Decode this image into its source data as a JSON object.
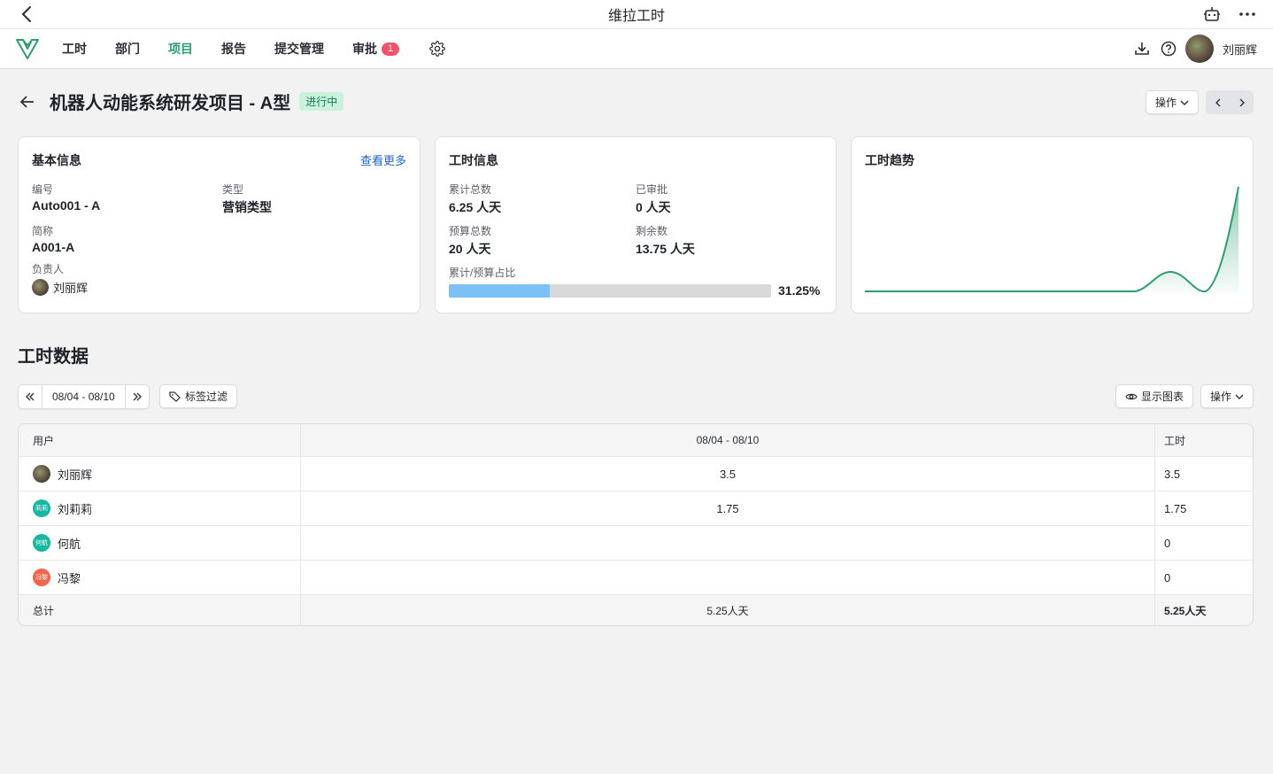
{
  "window": {
    "title": "维拉工时"
  },
  "nav": {
    "items": [
      {
        "label": "工时"
      },
      {
        "label": "部门"
      },
      {
        "label": "项目"
      },
      {
        "label": "报告"
      },
      {
        "label": "提交管理"
      },
      {
        "label": "审批"
      }
    ],
    "approval_badge": "1",
    "user_name": "刘丽辉"
  },
  "project": {
    "title": "机器人动能系统研发项目 - A型",
    "status": "进行中",
    "actions_label": "操作"
  },
  "basic_info": {
    "title": "基本信息",
    "more_link": "查看更多",
    "code_label": "编号",
    "code_value": "Auto001 - A",
    "type_label": "类型",
    "type_value": "营销类型",
    "short_label": "简称",
    "short_value": "A001-A",
    "owner_label": "负责人",
    "owner_value": "刘丽辉"
  },
  "hours_info": {
    "title": "工时信息",
    "total_label": "累计总数",
    "total_value": "6.25 人天",
    "approved_label": "已审批",
    "approved_value": "0 人天",
    "budget_label": "预算总数",
    "budget_value": "20 人天",
    "remaining_label": "剩余数",
    "remaining_value": "13.75 人天",
    "ratio_label": "累计/预算占比",
    "ratio_text": "31.25%",
    "ratio_fraction": 0.3125
  },
  "trend": {
    "title": "工时趋势",
    "line_color": "#2f9e6e"
  },
  "section": {
    "title": "工时数据"
  },
  "toolbar": {
    "date_range": "08/04 - 08/10",
    "tag_filter": "标签过滤",
    "show_chart": "显示图表",
    "actions": "操作"
  },
  "table": {
    "headers": {
      "user": "用户",
      "period": "08/04 - 08/10",
      "hours": "工时"
    },
    "rows": [
      {
        "name": "刘丽辉",
        "period": "3.5",
        "hours": "3.5",
        "avatar": "photo",
        "color": "#6b5a48"
      },
      {
        "name": "刘莉莉",
        "period": "1.75",
        "hours": "1.75",
        "avatar": "莉莉",
        "color": "#17b7a0"
      },
      {
        "name": "何航",
        "period": "",
        "hours": "0",
        "avatar": "何航",
        "color": "#17b7a0"
      },
      {
        "name": "冯黎",
        "period": "",
        "hours": "0",
        "avatar": "冯黎",
        "color": "#f0654c"
      }
    ],
    "footer": {
      "label": "总计",
      "period": "5.25人天",
      "hours": "5.25人天"
    }
  }
}
